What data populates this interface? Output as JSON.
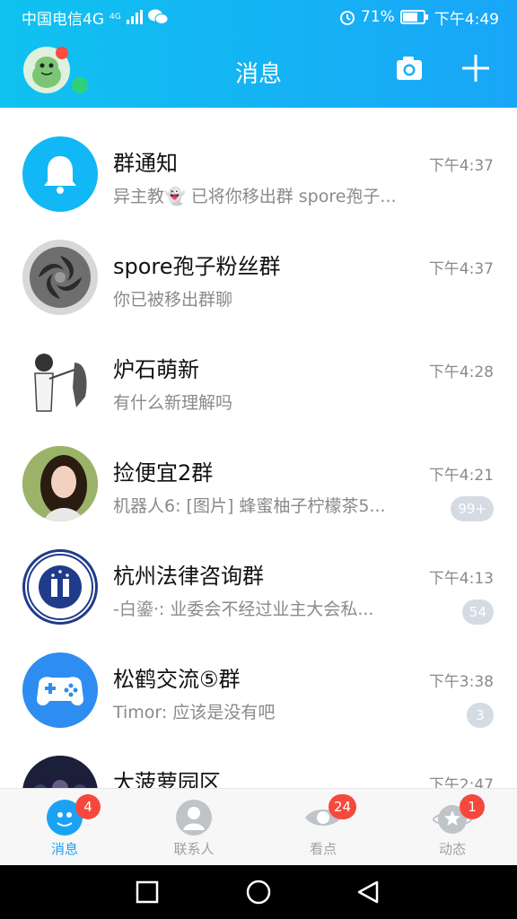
{
  "status_bar": {
    "carrier": "中国电信4G",
    "network_small": "4G",
    "battery": "71%",
    "time": "下午4:49"
  },
  "header": {
    "title": "消息"
  },
  "conversations": [
    {
      "name": "群通知",
      "message": "异主教👻 已将你移出群 spore孢子...",
      "time": "下午4:37",
      "badge": ""
    },
    {
      "name": "spore孢子粉丝群",
      "message": "你已被移出群聊",
      "time": "下午4:37",
      "badge": ""
    },
    {
      "name": "炉石萌新",
      "message": "有什么新理解吗",
      "time": "下午4:28",
      "badge": ""
    },
    {
      "name": "捡便宜2群",
      "message": "机器人6: [图片] 蜂蜜柚子柠檬茶5...",
      "time": "下午4:21",
      "badge": "99+"
    },
    {
      "name": "杭州法律咨询群",
      "message": "-白鎏·: 业委会不经过业主大会私...",
      "time": "下午4:13",
      "badge": "54"
    },
    {
      "name": "松鹤交流⑤群",
      "message": "Timor: 应该是没有吧",
      "time": "下午3:38",
      "badge": "3"
    },
    {
      "name": "大菠萝园区",
      "message": "",
      "time": "下午2:47",
      "badge": ""
    }
  ],
  "tabs": [
    {
      "label": "消息",
      "badge": "4"
    },
    {
      "label": "联系人",
      "badge": ""
    },
    {
      "label": "看点",
      "badge": "24"
    },
    {
      "label": "动态",
      "badge": "1"
    }
  ],
  "colors": {
    "header_gradient_start": "#10c2f0",
    "header_gradient_end": "#19a6f7",
    "active_tab": "#1aa3f4",
    "tab_badge": "#f5493d",
    "muted_badge": "#d4dbe3"
  }
}
